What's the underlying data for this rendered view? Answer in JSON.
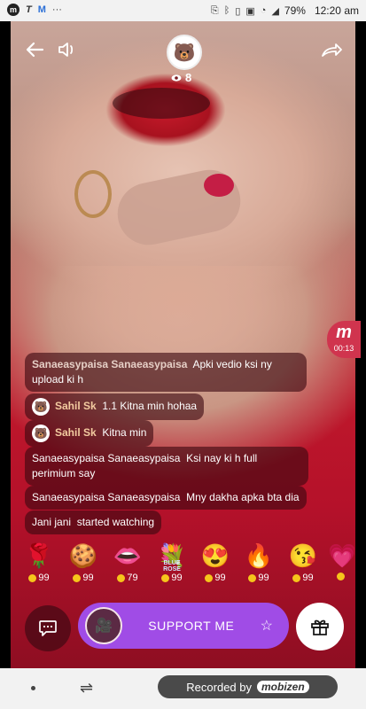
{
  "status_bar": {
    "battery": "79%",
    "time": "12:20 am",
    "left_icons": [
      "m-app-icon",
      "t-icon",
      "m-blue-icon",
      "more-dots-icon"
    ],
    "right_icons": [
      "cast-icon",
      "bluetooth-icon",
      "vibrate-icon",
      "battery-saver-icon",
      "wifi-icon",
      "signal-icon"
    ]
  },
  "top": {
    "viewer_count": "8",
    "back_icon": "back-arrow-icon",
    "sound_icon": "speaker-icon",
    "share_icon": "share-icon"
  },
  "rec_badge": {
    "time": "00:13"
  },
  "chat": [
    {
      "user": "Sanaeasypaisa Sanaeasypaisa",
      "text": "Apki vedio ksi ny upload ki h",
      "avatar": false
    },
    {
      "user": "Sahil Sk",
      "text": "1.1 Kitna min hohaa",
      "avatar": true
    },
    {
      "user": "Sahil Sk",
      "text": "Kitna min",
      "avatar": true
    },
    {
      "user": "Sanaeasypaisa Sanaeasypaisa",
      "text": "Ksi nay ki h full perimium say",
      "avatar": false
    },
    {
      "user": "Sanaeasypaisa Sanaeasypaisa",
      "text": "Mny dakha apka bta dia",
      "avatar": false
    },
    {
      "user": "Jani jani",
      "text": "started watching",
      "avatar": false
    }
  ],
  "gifts": [
    {
      "name": "rose",
      "cost": "99",
      "glyph": "🌹"
    },
    {
      "name": "cookie",
      "cost": "99",
      "glyph": "🍪"
    },
    {
      "name": "lips",
      "cost": "79",
      "glyph": "👄"
    },
    {
      "name": "blue-rose",
      "cost": "99",
      "glyph": "💐",
      "caption": "BLUE ROSE"
    },
    {
      "name": "heart-eyes",
      "cost": "99",
      "glyph": "😍"
    },
    {
      "name": "fire",
      "cost": "99",
      "glyph": "🔥"
    },
    {
      "name": "kiss-face",
      "cost": "99",
      "glyph": "😘"
    },
    {
      "name": "pink-item",
      "cost": "",
      "glyph": "💗"
    }
  ],
  "bottom": {
    "support_label": "SUPPORT ME"
  },
  "nav": {
    "recorded_label": "Recorded by",
    "recorder_brand": "mobizen"
  }
}
